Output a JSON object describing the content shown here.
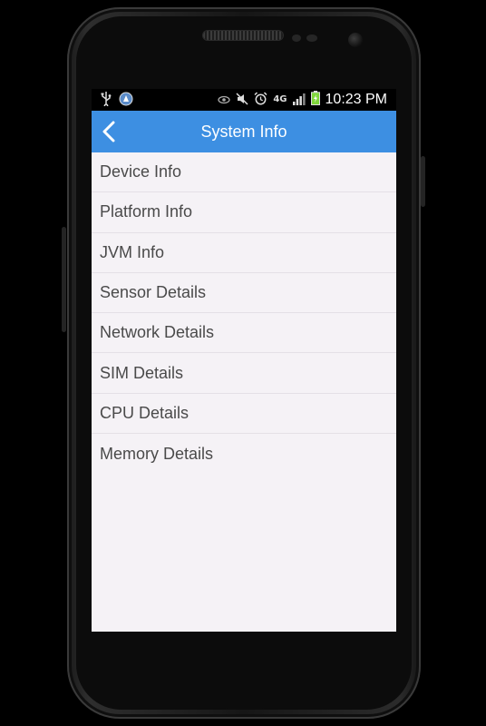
{
  "status_bar": {
    "time": "10:23 PM",
    "network": "4G",
    "icons": [
      "usb-icon",
      "app-notification-icon",
      "eye-icon",
      "mute-icon",
      "alarm-icon",
      "data-arrows-icon",
      "signal-icon",
      "battery-charging-icon"
    ]
  },
  "app_bar": {
    "title": "System Info",
    "back_icon": "chevron-left-icon"
  },
  "menu": {
    "items": [
      {
        "label": "Device Info"
      },
      {
        "label": "Platform Info"
      },
      {
        "label": "JVM Info"
      },
      {
        "label": "Sensor Details"
      },
      {
        "label": "Network Details"
      },
      {
        "label": "SIM Details"
      },
      {
        "label": "CPU Details"
      },
      {
        "label": "Memory Details"
      }
    ]
  },
  "colors": {
    "app_bar": "#3d8fe2",
    "background": "#f5f2f6",
    "text": "#4a4a4a",
    "battery": "#7fd63a"
  }
}
